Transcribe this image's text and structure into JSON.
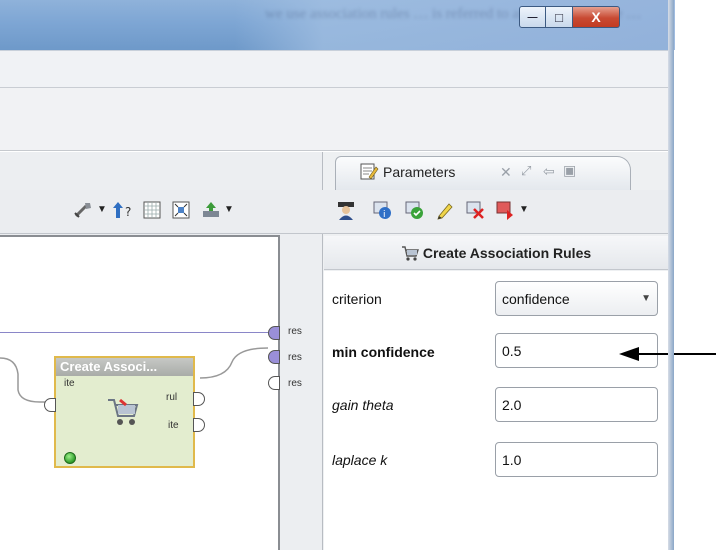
{
  "window": {
    "background_text": "we use association rules … is referred to as association rule …",
    "minimize_symbol": "—",
    "maximize_symbol": "□",
    "close_symbol": "X"
  },
  "process": {
    "result_ports": [
      "res",
      "res",
      "res"
    ],
    "operator": {
      "title": "Create Associ...",
      "input_port": "ite",
      "output_ports": [
        "rul",
        "ite"
      ],
      "status": "ok"
    }
  },
  "parameters": {
    "tab_label": "Parameters",
    "operator_name": "Create Association Rules",
    "fields": {
      "criterion": {
        "label": "criterion",
        "value": "confidence"
      },
      "min_confidence": {
        "label": "min confidence",
        "value": "0.5"
      },
      "gain_theta": {
        "label": "gain theta",
        "value": "2.0"
      },
      "laplace_k": {
        "label": "laplace k",
        "value": "1.0"
      }
    }
  },
  "colors": {
    "operator_fill": "#e3edcf",
    "operator_border": "#e0b94b",
    "connection_line": "#8a86c8",
    "title_bar": "#7ea6d4"
  }
}
